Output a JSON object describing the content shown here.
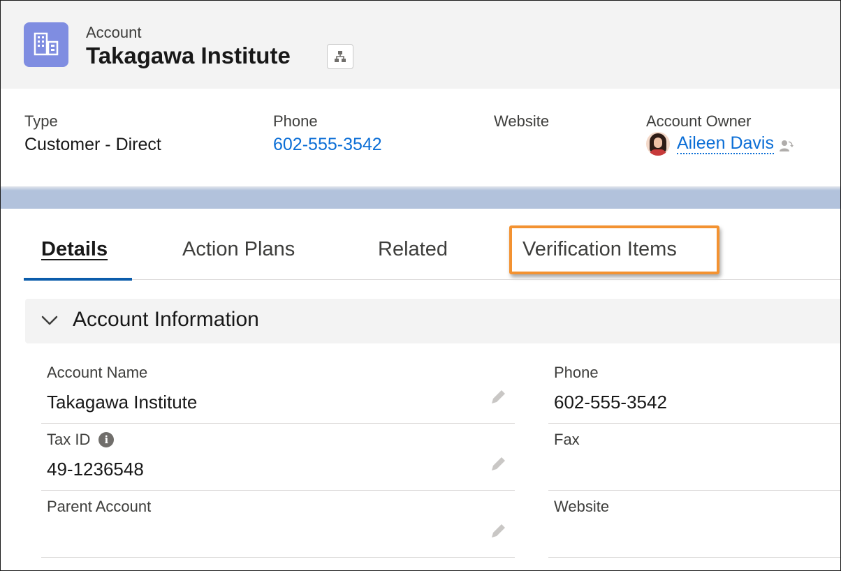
{
  "header": {
    "object_type": "Account",
    "record_name": "Takagawa Institute",
    "object_icon": "account-icon",
    "hierarchy_icon": "hierarchy-icon"
  },
  "highlights": {
    "type_label": "Type",
    "type_value": "Customer - Direct",
    "phone_label": "Phone",
    "phone_value": "602-555-3542",
    "website_label": "Website",
    "owner_label": "Account Owner",
    "owner_name": "Aileen Davis"
  },
  "tabs": [
    {
      "label": "Details",
      "active": true
    },
    {
      "label": "Action Plans",
      "active": false
    },
    {
      "label": "Related",
      "active": false
    },
    {
      "label": "Verification Items",
      "active": false,
      "highlighted": true
    }
  ],
  "section": {
    "title": "Account Information",
    "expanded": true
  },
  "fields": {
    "account_name_label": "Account Name",
    "account_name_value": "Takagawa Institute",
    "tax_id_label": "Tax ID",
    "tax_id_value": "49-1236548",
    "parent_account_label": "Parent Account",
    "parent_account_value": "",
    "phone_label": "Phone",
    "phone_value": "602-555-3542",
    "fax_label": "Fax",
    "fax_value": "",
    "website_label": "Website",
    "website_value": ""
  },
  "colors": {
    "link": "#0b6ed6",
    "brand_icon": "#7f8de1",
    "highlight_border": "#f39231",
    "active_tab": "#0b5cab"
  }
}
